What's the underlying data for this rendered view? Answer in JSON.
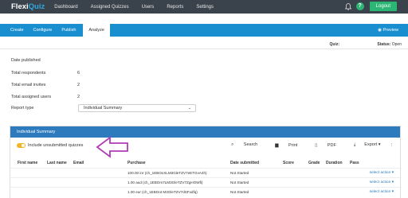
{
  "app": {
    "logo_prefix": "Flexi",
    "logo_suffix": "Quiz"
  },
  "topnav": [
    "Dashboard",
    "Assigned Quizzes",
    "Users",
    "Reports",
    "Settings"
  ],
  "logout_label": "Logout",
  "subtabs": [
    "Create",
    "Configure",
    "Publish",
    "Analyze"
  ],
  "preview_label": "Preview",
  "quiz_label": "Quiz:",
  "status_label": "Status:",
  "status_value": "Open",
  "info": {
    "date_published": "Date published",
    "total_respondents": "Total respondents",
    "total_respondents_value": "6",
    "total_email_invites": "Total email invites",
    "total_email_invites_value": "2",
    "total_assigned_users": "Total assigned users",
    "total_assigned_users_value": "2",
    "report_type": "Report type",
    "report_type_value": "Individual Summary"
  },
  "card": {
    "title": "Individual Summary",
    "toggle_label": "Include unsubmitted quizzes",
    "tools": [
      "Search",
      "Print",
      "PDF",
      "Export"
    ],
    "columns": [
      "First name",
      "Last name",
      "Email",
      "Purchase",
      "Date submitted",
      "Score",
      "Grade",
      "Duration",
      "Pass"
    ],
    "rows": [
      {
        "purchase": "100.00 inr (ch_1EBOxXLM3GleTZV7eETGvA4h)",
        "date": "Not Started",
        "action": "select action"
      },
      {
        "purchase": "1.00 aud (ch_1EBOm7LM3GleTZV7ZgHOWfi)",
        "date": "Not Started",
        "action": "select action"
      },
      {
        "purchase": "1.00 eur (ch_1EBOot M3GleTZV7dSFxdfq)",
        "date": "Not Started",
        "action": "select action"
      }
    ]
  }
}
